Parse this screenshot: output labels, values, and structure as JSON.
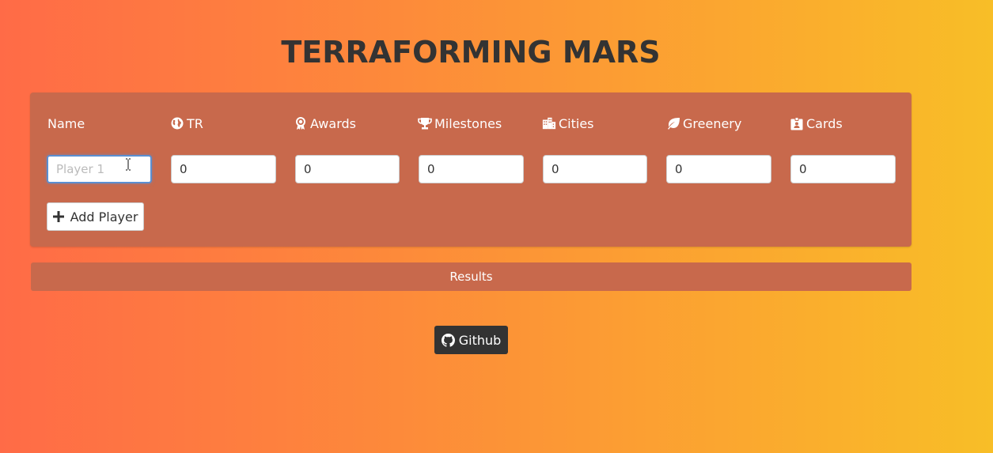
{
  "app": {
    "title": "TERRAFORMING MARS"
  },
  "table": {
    "columns": [
      {
        "label": "Name",
        "icon": ""
      },
      {
        "label": "TR",
        "icon": "globe-icon"
      },
      {
        "label": "Awards",
        "icon": "award-icon"
      },
      {
        "label": "Milestones",
        "icon": "trophy-icon"
      },
      {
        "label": "Cities",
        "icon": "city-icon"
      },
      {
        "label": "Greenery",
        "icon": "leaf-icon"
      },
      {
        "label": "Cards",
        "icon": "id-card-icon"
      }
    ],
    "row": {
      "name_placeholder": "Player 1",
      "name_value": "",
      "tr": "0",
      "awards": "0",
      "milestones": "0",
      "cities": "0",
      "greenery": "0",
      "cards": "0"
    },
    "add_player_label": "Add Player"
  },
  "results": {
    "label": "Results"
  },
  "footer": {
    "github_label": "Github",
    "github_icon": "github-icon"
  },
  "colors": {
    "panel": "#c8694c",
    "title": "#333333",
    "github_button": "#333333",
    "gradient_start": "#ff6b47",
    "gradient_end": "#f8be27"
  }
}
